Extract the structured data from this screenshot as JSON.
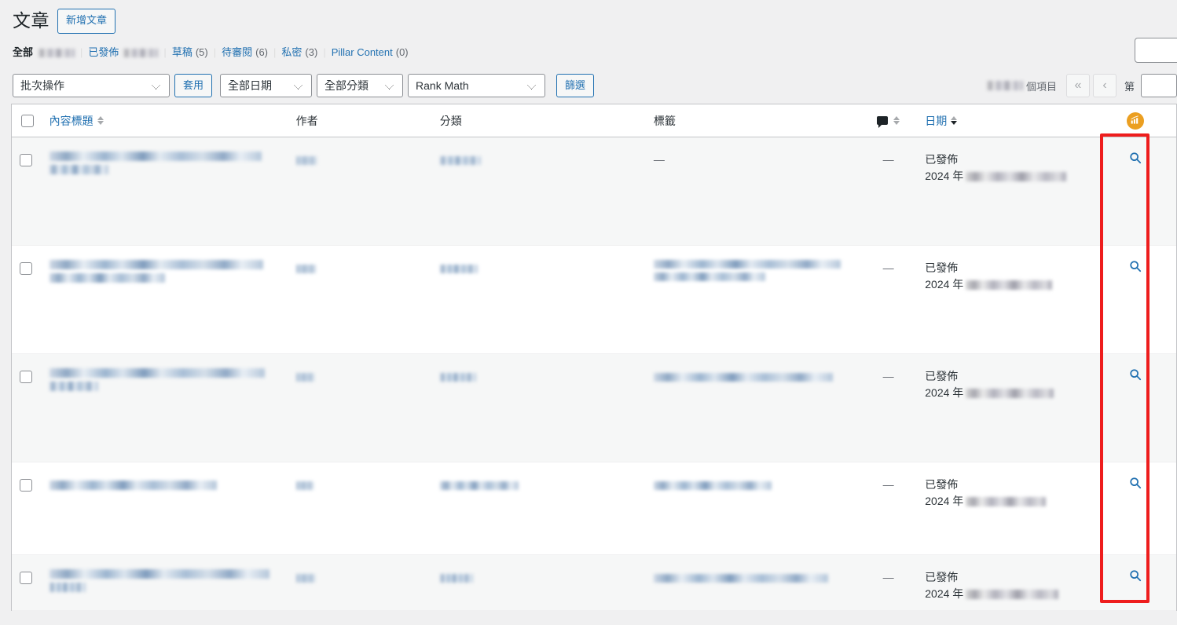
{
  "header": {
    "page_title": "文章",
    "add_new_label": "新增文章"
  },
  "status_links": {
    "all_label": "全部",
    "all_count_redacted": true,
    "items": [
      {
        "label": "全部",
        "count": "",
        "redacted": true,
        "current": true
      },
      {
        "label": "已發佈",
        "count": "",
        "redacted": true,
        "current": false
      },
      {
        "label": "草稿",
        "count": "(5)",
        "redacted": false,
        "current": false
      },
      {
        "label": "待審閱",
        "count": "(6)",
        "redacted": false,
        "current": false
      },
      {
        "label": "私密",
        "count": "(3)",
        "redacted": false,
        "current": false
      },
      {
        "label": "Pillar Content",
        "count": "(0)",
        "redacted": false,
        "current": false
      }
    ],
    "separator": "|"
  },
  "search": {
    "value": "",
    "placeholder": ""
  },
  "toolbar": {
    "bulk_action_selected": "批次操作",
    "apply_label": "套用",
    "date_filter_selected": "全部日期",
    "category_filter_selected": "全部分類",
    "rank_math_filter_selected": "Rank Math",
    "filter_label": "篩選"
  },
  "pagination": {
    "items_count_redacted": true,
    "items_suffix": "個項目",
    "first_page_label": "«",
    "prev_page_label": "‹",
    "paging_prefix": "第",
    "current_page": ""
  },
  "table": {
    "columns": [
      {
        "key": "cb",
        "label": "",
        "sortable": false
      },
      {
        "key": "title",
        "label": "內容標題",
        "sortable": true,
        "sort_state": "none",
        "link": true
      },
      {
        "key": "author",
        "label": "作者",
        "sortable": false,
        "link": false
      },
      {
        "key": "categories",
        "label": "分類",
        "sortable": false,
        "link": false
      },
      {
        "key": "tags",
        "label": "標籤",
        "sortable": false,
        "link": false
      },
      {
        "key": "comments",
        "label": "",
        "icon": "comment-bubble-icon",
        "sortable": true,
        "sort_state": "none"
      },
      {
        "key": "date",
        "label": "日期",
        "sortable": true,
        "sort_state": "desc",
        "link": true
      },
      {
        "key": "rankmath",
        "label": "",
        "icon": "rank-math-icon",
        "sortable": false
      }
    ],
    "rows": [
      {
        "title_lines": 2,
        "author_redacted": true,
        "categories_redacted": true,
        "tags": "—",
        "tags_redacted": false,
        "comments": "—",
        "date_status": "已發佈",
        "date_prefix": "2024 年",
        "date_redacted": true,
        "action_icon": "magnifier-icon"
      },
      {
        "title_lines": 2,
        "author_redacted": true,
        "categories_redacted": true,
        "tags": "",
        "tags_redacted": true,
        "tags_lines": 2,
        "comments": "—",
        "date_status": "已發佈",
        "date_prefix": "2024 年",
        "date_redacted": true,
        "action_icon": "magnifier-icon"
      },
      {
        "title_lines": 2,
        "author_redacted": true,
        "categories_redacted": true,
        "tags": "",
        "tags_redacted": true,
        "tags_lines": 1,
        "comments": "—",
        "date_status": "已發佈",
        "date_prefix": "2024 年",
        "date_redacted": true,
        "action_icon": "magnifier-icon"
      },
      {
        "title_lines": 1,
        "author_redacted": true,
        "categories_redacted": true,
        "tags": "",
        "tags_redacted": true,
        "tags_lines": 1,
        "comments": "—",
        "date_status": "已發佈",
        "date_prefix": "2024 年",
        "date_redacted": true,
        "action_icon": "magnifier-icon"
      },
      {
        "title_lines": 2,
        "author_redacted": true,
        "categories_redacted": true,
        "tags": "",
        "tags_redacted": true,
        "tags_lines": 1,
        "comments": "—",
        "date_status": "已發佈",
        "date_prefix": "2024 年",
        "date_redacted": true,
        "action_icon": "magnifier-icon"
      }
    ]
  },
  "annotation": {
    "type": "red-rectangle-highlight",
    "color": "#ee1d1d",
    "target": "rank-math-column"
  },
  "colors": {
    "link": "#2271b1",
    "text": "#2c3338",
    "muted": "#646970",
    "page_bg": "#f0f0f1",
    "row_alt_bg": "#f6f7f7",
    "rank_math_orange": "#eb9f21",
    "annotation_red": "#ee1d1d"
  }
}
